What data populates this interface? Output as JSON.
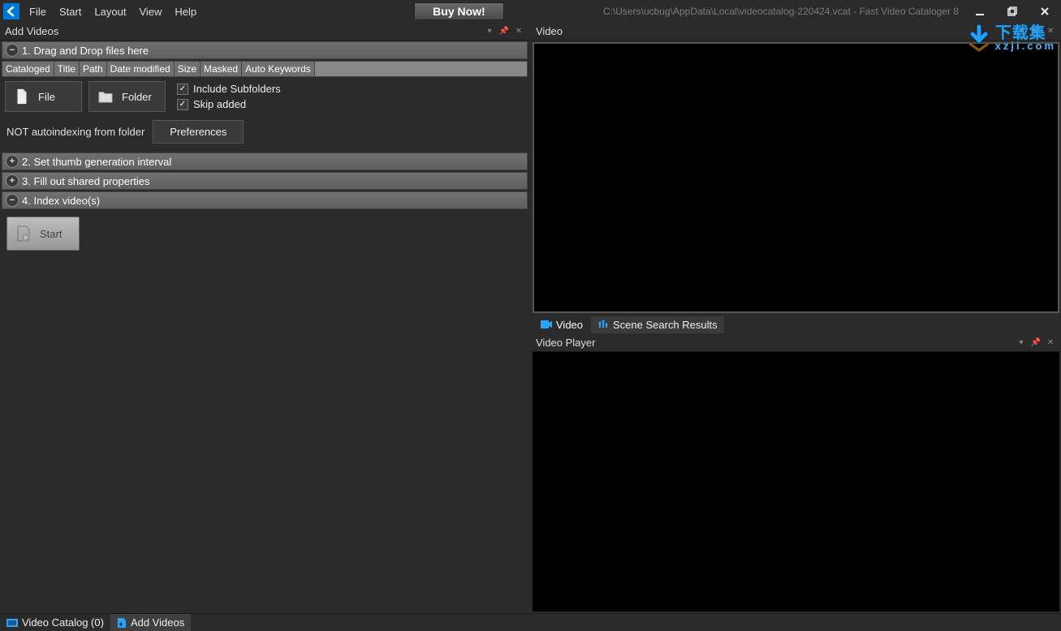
{
  "titlebar": {
    "path": "C:\\Users\\ucbug\\AppData\\Local\\videocatalog-220424.vcat - Fast Video Cataloger 8"
  },
  "menu": {
    "file": "File",
    "start": "Start",
    "layout": "Layout",
    "view": "View",
    "help": "Help"
  },
  "buy": "Buy Now!",
  "left": {
    "panel_title": "Add Videos",
    "sec1": "1. Drag and Drop files here",
    "sec2": "2. Set thumb generation interval",
    "sec3": "3. Fill out shared properties",
    "sec4": "4. Index video(s)",
    "cols": {
      "cataloged": "Cataloged",
      "title": "Title",
      "path": "Path",
      "date": "Date modified",
      "size": "Size",
      "masked": "Masked",
      "autokw": "Auto Keywords"
    },
    "btn_file": "File",
    "btn_folder": "Folder",
    "chk_sub": "Include Subfolders",
    "chk_skip": "Skip added",
    "autoindex": "NOT autoindexing from folder",
    "prefs": "Preferences",
    "start": "Start"
  },
  "right": {
    "video_title": "Video",
    "tab_video": "Video",
    "tab_scene": "Scene Search Results",
    "player_title": "Video Player"
  },
  "bottom": {
    "catalog": "Video Catalog (0)",
    "add": "Add Videos"
  },
  "watermark": {
    "top": "下载集",
    "bot": "xzji.com"
  }
}
